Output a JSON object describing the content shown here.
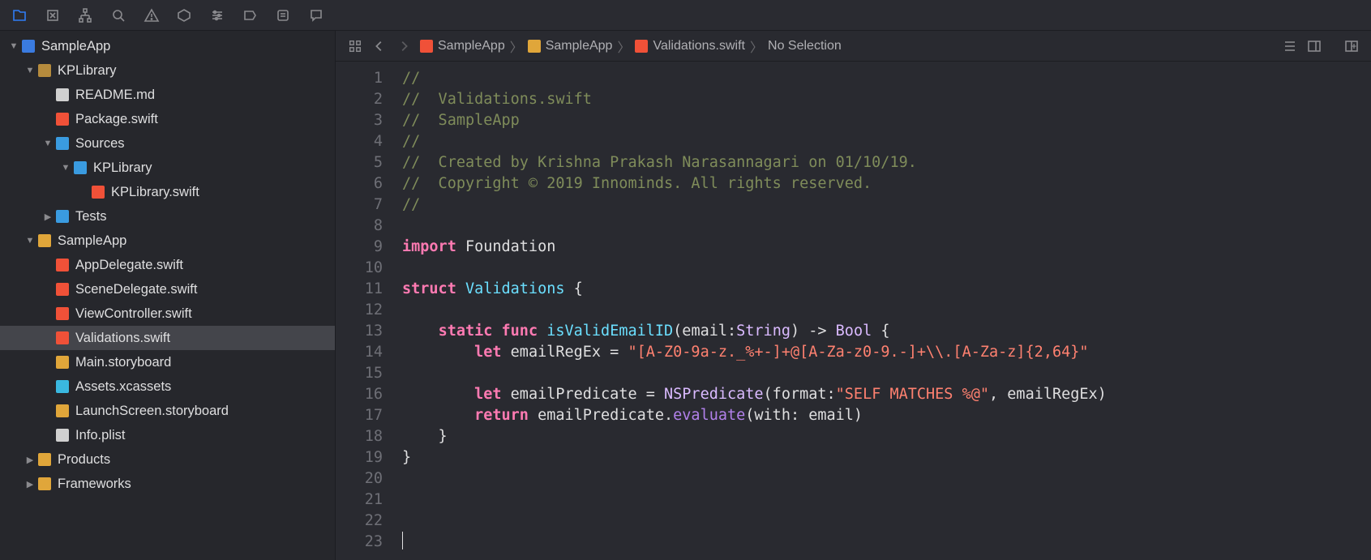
{
  "toolbar_icons": [
    "files",
    "symbols",
    "hierarchy",
    "search",
    "issues",
    "tests",
    "debug",
    "breakpoints",
    "reports",
    "chat"
  ],
  "breadcrumbs": [
    {
      "icon": "swift",
      "label": "SampleApp"
    },
    {
      "icon": "folder-y",
      "label": "SampleApp"
    },
    {
      "icon": "swift",
      "label": "Validations.swift"
    },
    {
      "icon": "",
      "label": "No Selection"
    }
  ],
  "tree": [
    {
      "depth": 0,
      "disclosure": "▼",
      "icon": "proj",
      "label": "SampleApp"
    },
    {
      "depth": 1,
      "disclosure": "▼",
      "icon": "pkg",
      "label": "KPLibrary"
    },
    {
      "depth": 2,
      "disclosure": "",
      "icon": "md",
      "label": "README.md"
    },
    {
      "depth": 2,
      "disclosure": "",
      "icon": "swift",
      "label": "Package.swift"
    },
    {
      "depth": 2,
      "disclosure": "▼",
      "icon": "fold-b",
      "label": "Sources"
    },
    {
      "depth": 3,
      "disclosure": "▼",
      "icon": "fold-b",
      "label": "KPLibrary"
    },
    {
      "depth": 4,
      "disclosure": "",
      "icon": "swift",
      "label": "KPLibrary.swift"
    },
    {
      "depth": 2,
      "disclosure": "▶",
      "icon": "fold-b",
      "label": "Tests"
    },
    {
      "depth": 1,
      "disclosure": "▼",
      "icon": "fold-y",
      "label": "SampleApp"
    },
    {
      "depth": 2,
      "disclosure": "",
      "icon": "swift",
      "label": "AppDelegate.swift"
    },
    {
      "depth": 2,
      "disclosure": "",
      "icon": "swift",
      "label": "SceneDelegate.swift"
    },
    {
      "depth": 2,
      "disclosure": "",
      "icon": "swift",
      "label": "ViewController.swift"
    },
    {
      "depth": 2,
      "disclosure": "",
      "icon": "swift",
      "label": "Validations.swift",
      "selected": true
    },
    {
      "depth": 2,
      "disclosure": "",
      "icon": "sb",
      "label": "Main.storyboard"
    },
    {
      "depth": 2,
      "disclosure": "",
      "icon": "xc",
      "label": "Assets.xcassets"
    },
    {
      "depth": 2,
      "disclosure": "",
      "icon": "sb",
      "label": "LaunchScreen.storyboard"
    },
    {
      "depth": 2,
      "disclosure": "",
      "icon": "plist",
      "label": "Info.plist"
    },
    {
      "depth": 1,
      "disclosure": "▶",
      "icon": "fold-y",
      "label": "Products"
    },
    {
      "depth": 1,
      "disclosure": "▶",
      "icon": "fold-y",
      "label": "Frameworks"
    }
  ],
  "code_lines": [
    [
      {
        "c": "comment",
        "t": "//"
      }
    ],
    [
      {
        "c": "comment",
        "t": "//  Validations.swift"
      }
    ],
    [
      {
        "c": "comment",
        "t": "//  SampleApp"
      }
    ],
    [
      {
        "c": "comment",
        "t": "//"
      }
    ],
    [
      {
        "c": "comment",
        "t": "//  Created by Krishna Prakash Narasannagari on 01/10/19."
      }
    ],
    [
      {
        "c": "comment",
        "t": "//  Copyright © 2019 Innominds. All rights reserved."
      }
    ],
    [
      {
        "c": "comment",
        "t": "//"
      }
    ],
    [],
    [
      {
        "c": "keyword",
        "t": "import"
      },
      {
        "c": "plain",
        "t": " Foundation"
      }
    ],
    [],
    [
      {
        "c": "keyword",
        "t": "struct"
      },
      {
        "c": "plain",
        "t": " "
      },
      {
        "c": "type",
        "t": "Validations"
      },
      {
        "c": "plain",
        "t": " {"
      }
    ],
    [],
    [
      {
        "c": "plain",
        "t": "    "
      },
      {
        "c": "keyword",
        "t": "static func"
      },
      {
        "c": "plain",
        "t": " "
      },
      {
        "c": "func",
        "t": "isValidEmailID"
      },
      {
        "c": "plain",
        "t": "(email:"
      },
      {
        "c": "typesys",
        "t": "String"
      },
      {
        "c": "plain",
        "t": ") -> "
      },
      {
        "c": "typesys",
        "t": "Bool"
      },
      {
        "c": "plain",
        "t": " {"
      }
    ],
    [
      {
        "c": "plain",
        "t": "        "
      },
      {
        "c": "keyword",
        "t": "let"
      },
      {
        "c": "plain",
        "t": " emailRegEx = "
      },
      {
        "c": "string",
        "t": "\"[A-Z0-9a-z._%+-]+@[A-Za-z0-9.-]+\\\\.[A-Za-z]{2,64}\""
      }
    ],
    [],
    [
      {
        "c": "plain",
        "t": "        "
      },
      {
        "c": "keyword",
        "t": "let"
      },
      {
        "c": "plain",
        "t": " emailPredicate = "
      },
      {
        "c": "typesys",
        "t": "NSPredicate"
      },
      {
        "c": "plain",
        "t": "(format:"
      },
      {
        "c": "string",
        "t": "\"SELF MATCHES %@\""
      },
      {
        "c": "plain",
        "t": ", emailRegEx)"
      }
    ],
    [
      {
        "c": "plain",
        "t": "        "
      },
      {
        "c": "keyword",
        "t": "return"
      },
      {
        "c": "plain",
        "t": " emailPredicate."
      },
      {
        "c": "funccall",
        "t": "evaluate"
      },
      {
        "c": "plain",
        "t": "(with: email)"
      }
    ],
    [
      {
        "c": "plain",
        "t": "    }"
      }
    ],
    [
      {
        "c": "plain",
        "t": "}"
      }
    ],
    [],
    [],
    [],
    []
  ],
  "line_start": 1,
  "line_count": 23
}
